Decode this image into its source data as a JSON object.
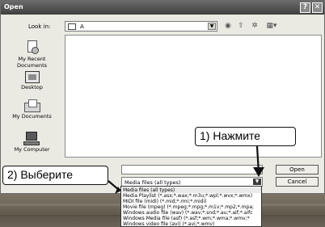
{
  "window": {
    "title": "Open",
    "help_label": "?",
    "close_label": "✕"
  },
  "look_in": {
    "label": "Look in:",
    "value": "A"
  },
  "toolbar": [
    "back-icon",
    "up-folder-icon",
    "new-folder-icon",
    "views-menu-icon"
  ],
  "places": [
    {
      "label": "My Recent Documents",
      "icon": "recent-documents-icon"
    },
    {
      "label": "Desktop",
      "icon": "desktop-icon"
    },
    {
      "label": "My Documents",
      "icon": "my-documents-icon"
    },
    {
      "label": "My Computer",
      "icon": "my-computer-icon"
    }
  ],
  "file_name": {
    "value": ""
  },
  "file_type": {
    "value": "Media files (all types)"
  },
  "buttons": {
    "open": "Open",
    "cancel": "Cancel"
  },
  "dropdown_items": [
    "Media files (all types)",
    "Media Playlist (*.asx;*.wax;*.m3u;*.wpl;*.wvx;*.wmx)",
    "MIDI file (midi) (*.mid;*.rmi;*.midi)",
    "Movie file (mpeg) (*.mpeg;*.mpg;*.m1v;*.mp2;*.mpa;",
    "Windows audio file (wav) (*.wav;*.snd;*.au;*.aif;*.aifc",
    "Windows Media file (asf) (*.asf;*.wm;*.wma;*.wmv;*",
    "Windows video file (avi) (*.avi;*.wmv)"
  ],
  "callouts": {
    "step1": "1) Нажмите",
    "step2": "2)  Выберите"
  }
}
